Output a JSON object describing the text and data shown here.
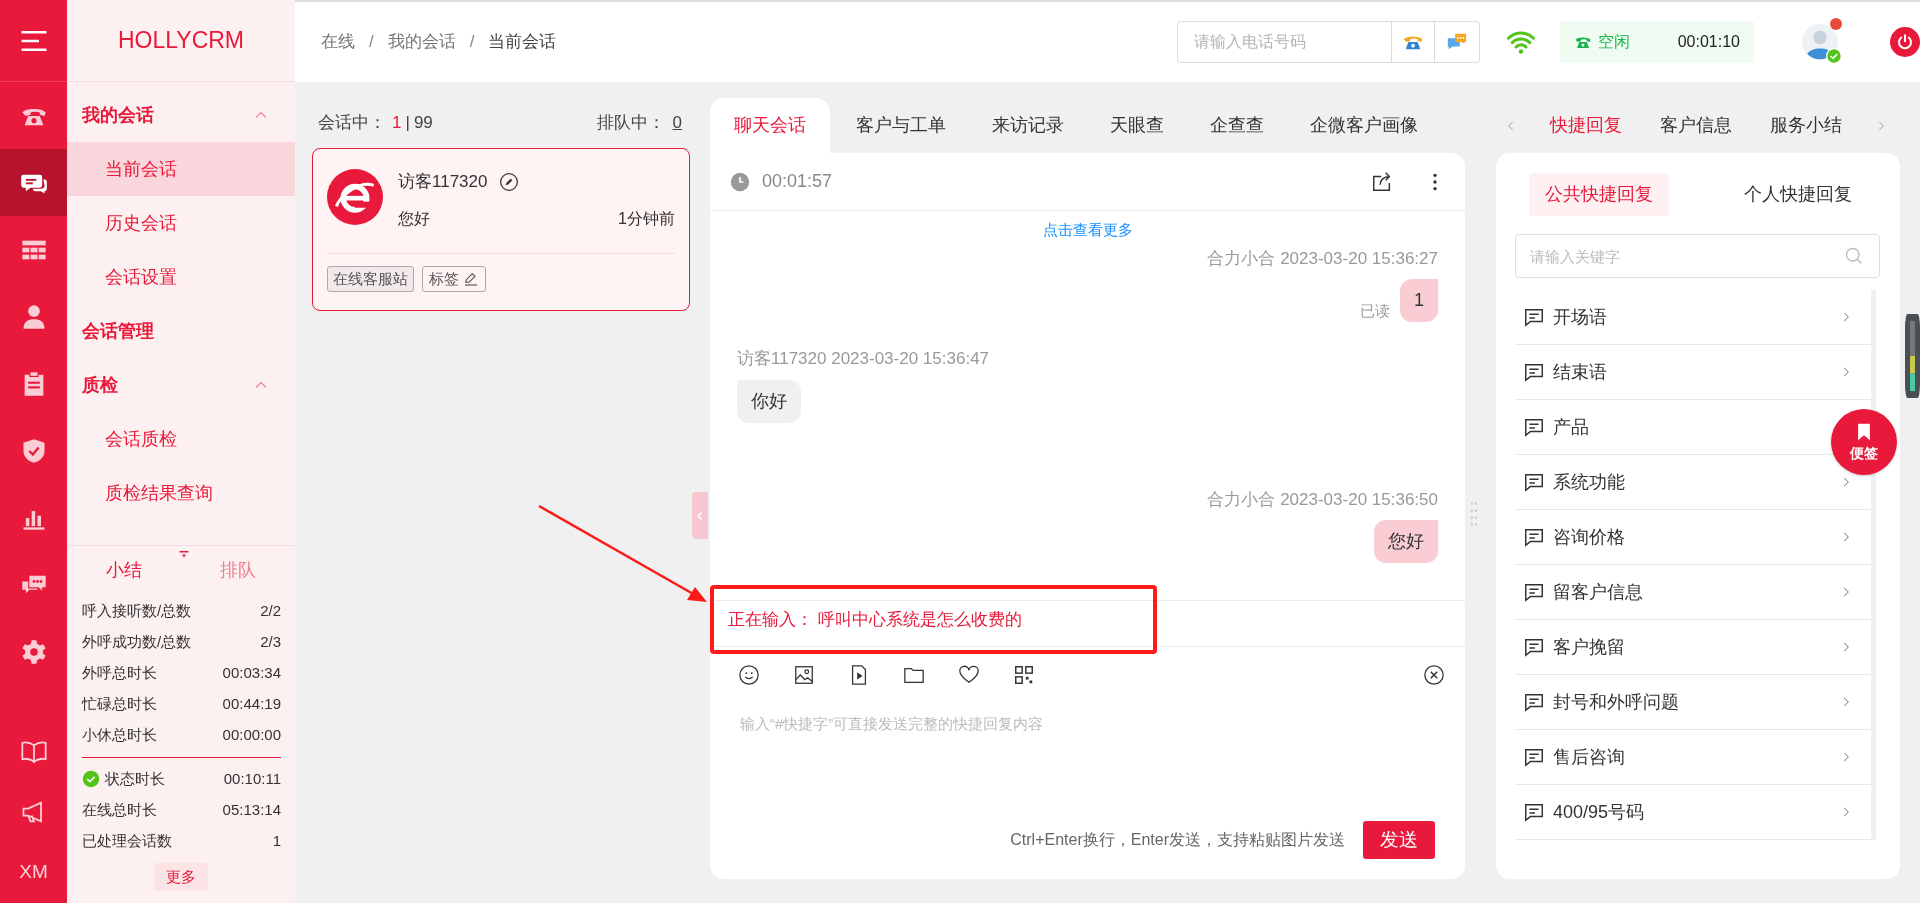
{
  "rail": {
    "items": [
      {
        "selected": false
      },
      {
        "selected": true
      },
      {
        "selected": false
      },
      {
        "selected": false
      },
      {
        "selected": false
      },
      {
        "selected": false
      },
      {
        "selected": false
      },
      {
        "selected": false
      },
      {
        "selected": false
      }
    ],
    "footer": "XM"
  },
  "brand": "HOLLYCRM",
  "nav": [
    {
      "label": "我的会话",
      "expanded": true,
      "children": [
        {
          "label": "当前会话",
          "selected": true
        },
        {
          "label": "历史会话",
          "selected": false
        },
        {
          "label": "会话设置",
          "selected": false
        }
      ]
    },
    {
      "label": "会话管理"
    },
    {
      "label": "质检",
      "expanded": true,
      "children": [
        {
          "label": "会话质检",
          "selected": false
        },
        {
          "label": "质检结果查询",
          "selected": false
        }
      ]
    }
  ],
  "summary": {
    "tabs": [
      {
        "label": "小结",
        "selected": true
      },
      {
        "label": "排队",
        "selected": false
      }
    ],
    "stats": [
      {
        "label": "呼入接听数/总数",
        "value": "2/2"
      },
      {
        "label": "外呼成功数/总数",
        "value": "2/3"
      },
      {
        "label": "外呼总时长",
        "value": "00:03:34"
      },
      {
        "label": "忙碌总时长",
        "value": "00:44:19"
      },
      {
        "label": "小休总时长",
        "value": "00:00:00"
      }
    ],
    "session_stats": [
      {
        "label": "状态时长",
        "value": "00:10:11",
        "kind": "status"
      },
      {
        "label": "在线总时长",
        "value": "05:13:14",
        "kind": "plain"
      },
      {
        "label": "已处理会话数",
        "value": "1",
        "kind": "plain"
      }
    ],
    "more": "更多"
  },
  "breadcrumb": [
    {
      "label": "在线"
    },
    {
      "separator": "/",
      "label": "我的会话"
    },
    {
      "separator": "/",
      "label": "当前会话"
    }
  ],
  "phone_search": {
    "placeholder": "请输入电话号码"
  },
  "agent": {
    "status": "空闲",
    "timer": "00:01:10",
    "online": true,
    "alert": true
  },
  "sessions": {
    "active_label": "会话中：",
    "active": "1",
    "count_separator": "|",
    "capacity": "99",
    "queue_label": "排队中：",
    "queue": "0",
    "items": [
      {
        "name": "访客117320",
        "last_message": "您好",
        "time": "1分钟前",
        "tags": [
          "在线客服站"
        ],
        "tag_button": "标签",
        "selected": true
      }
    ]
  },
  "chat": {
    "tabs": [
      {
        "label": "聊天会话",
        "selected": true
      },
      {
        "label": "客户与工单",
        "selected": false
      },
      {
        "label": "来访记录",
        "selected": false
      },
      {
        "label": "天眼查",
        "selected": false
      },
      {
        "label": "企查查",
        "selected": false
      },
      {
        "label": "企微客户画像",
        "selected": false
      }
    ],
    "timer": "00:01:57",
    "load_more": "点击查看更多",
    "messages": [
      {
        "kind": "agent",
        "meta": "合力小合 2023-03-20 15:36:27",
        "text": "1",
        "receipt": "已读"
      },
      {
        "kind": "visitor",
        "meta": "访客117320 2023-03-20 15:36:47",
        "text": "你好"
      },
      {
        "kind": "agent",
        "meta": "合力小合 2023-03-20 15:36:50",
        "text": "您好"
      }
    ],
    "typing": "正在输入： 呼叫中心系统是怎么收费的",
    "input": {
      "placeholder": "输入“#快捷字”可直接发送完整的快捷回复内容"
    },
    "hint": "Ctrl+Enter换行，Enter发送，支持粘贴图片发送",
    "send": "发送"
  },
  "quick": {
    "tabs": [
      {
        "label": "快捷回复",
        "selected": true
      },
      {
        "label": "客户信息",
        "selected": false
      },
      {
        "label": "服务小结",
        "selected": false
      }
    ],
    "subtabs": [
      {
        "label": "公共快捷回复",
        "selected": true
      },
      {
        "label": "个人快捷回复",
        "selected": false
      }
    ],
    "search": {
      "placeholder": "请输入关键字"
    },
    "categories": [
      "开场语",
      "结束语",
      "产品",
      "系统功能",
      "咨询价格",
      "留客户信息",
      "客户挽留",
      "封号和外呼问题",
      "售后咨询",
      "400/95号码"
    ]
  },
  "sticky_note": "便签"
}
